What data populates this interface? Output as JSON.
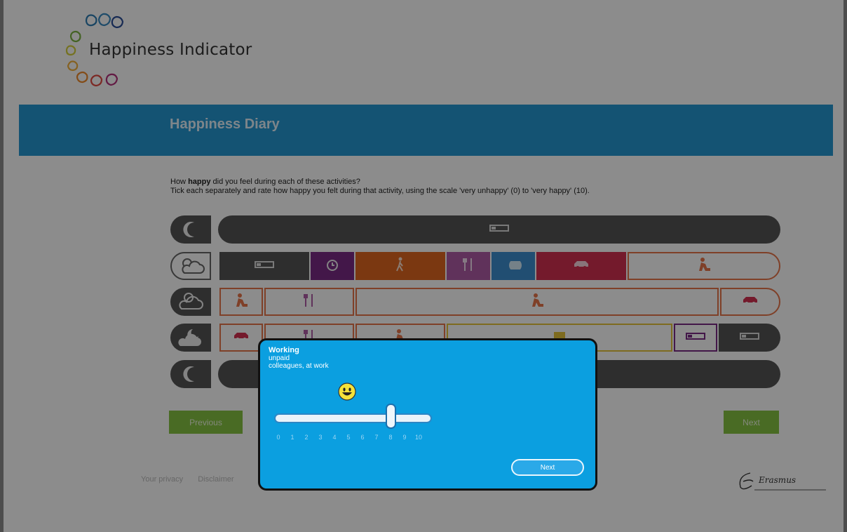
{
  "app": {
    "name": "Happiness Indicator"
  },
  "header": {
    "title": "Happiness Diary"
  },
  "instructions": {
    "line1_pre": "How ",
    "line1_bold": "happy",
    "line1_post": " did you feel during each of these activities?",
    "line2": "Tick each separately and rate how happy you felt during that activity, using the scale 'very unhappy' (0) to 'very happy' (10)."
  },
  "rows": [
    {
      "period": "night",
      "period_icon": "moon-icon",
      "segments": [
        {
          "icon": "bed-icon",
          "glyph": "▭",
          "color": "#555555",
          "style": "filled"
        }
      ]
    },
    {
      "period": "morning",
      "period_icon": "sun-cloud-icon",
      "segments": [
        {
          "icon": "bed-icon",
          "glyph": "▭",
          "color": "#555555",
          "style": "filled"
        },
        {
          "icon": "alarm-clock-icon",
          "glyph": "⏰",
          "color": "#7b2a86",
          "style": "filled"
        },
        {
          "icon": "walking-icon",
          "glyph": "🚶",
          "color": "#e0671f",
          "style": "filled"
        },
        {
          "icon": "cutlery-icon",
          "glyph": "🍴",
          "color": "#b05ca6",
          "style": "filled"
        },
        {
          "icon": "shower-icon",
          "glyph": "🚿",
          "color": "#3c8fd0",
          "style": "filled"
        },
        {
          "icon": "car-icon",
          "glyph": "🚗",
          "color": "#d43051",
          "style": "filled"
        },
        {
          "icon": "working-icon",
          "glyph": "⚒",
          "color": "#e8754a",
          "style": "outline"
        }
      ]
    },
    {
      "period": "afternoon",
      "period_icon": "cloud-sun-icon",
      "segments": [
        {
          "icon": "working-icon",
          "glyph": "⚒",
          "color": "#e8754a",
          "style": "outline"
        },
        {
          "icon": "cutlery-icon",
          "glyph": "🍴",
          "color": "#b05ca6",
          "style": "outline"
        },
        {
          "icon": "working-icon",
          "glyph": "⚒",
          "color": "#e8754a",
          "style": "outline"
        },
        {
          "icon": "car-icon",
          "glyph": "🚗",
          "color": "#d43051",
          "style": "outline"
        }
      ]
    },
    {
      "period": "evening",
      "period_icon": "cloud-moon-icon",
      "segments": [
        {
          "icon": "car-icon",
          "glyph": "🚗",
          "color": "#d43051",
          "style": "outline"
        },
        {
          "icon": "cutlery-icon",
          "glyph": "🍴",
          "color": "#b05ca6",
          "style": "outline"
        },
        {
          "icon": "working-icon",
          "glyph": "⚒",
          "color": "#e8754a",
          "style": "outline"
        },
        {
          "icon": "tv-icon",
          "glyph": "▭",
          "color": "#e6c43a",
          "style": "outline"
        },
        {
          "icon": "bed-icon",
          "glyph": "▭",
          "color": "#7b2a86",
          "style": "outline"
        },
        {
          "icon": "bed-icon",
          "glyph": "▭",
          "color": "#555555",
          "style": "filled"
        }
      ]
    },
    {
      "period": "night",
      "period_icon": "moon-icon",
      "segments": [
        {
          "icon": "bed-icon",
          "glyph": "▭",
          "color": "#555555",
          "style": "filled"
        }
      ]
    }
  ],
  "buttons": {
    "previous": "Previous",
    "next": "Next"
  },
  "footer": {
    "links": [
      "Your privacy",
      "Disclaimer"
    ],
    "signature": "Erasmus"
  },
  "dialog": {
    "title": "Working",
    "line1": "unpaid",
    "line2": "colleagues, at work",
    "mood_icon": "smiley-icon",
    "rating": 8,
    "scale_min": 0,
    "scale_max": 10,
    "scale_labels": [
      "0",
      "1",
      "2",
      "3",
      "4",
      "5",
      "6",
      "7",
      "8",
      "9",
      "10"
    ],
    "next_label": "Next"
  },
  "colors": {
    "band": "#2597d2",
    "dialog": "#0b9fe0",
    "button_green": "#86c442",
    "gray_segment": "#555555"
  }
}
